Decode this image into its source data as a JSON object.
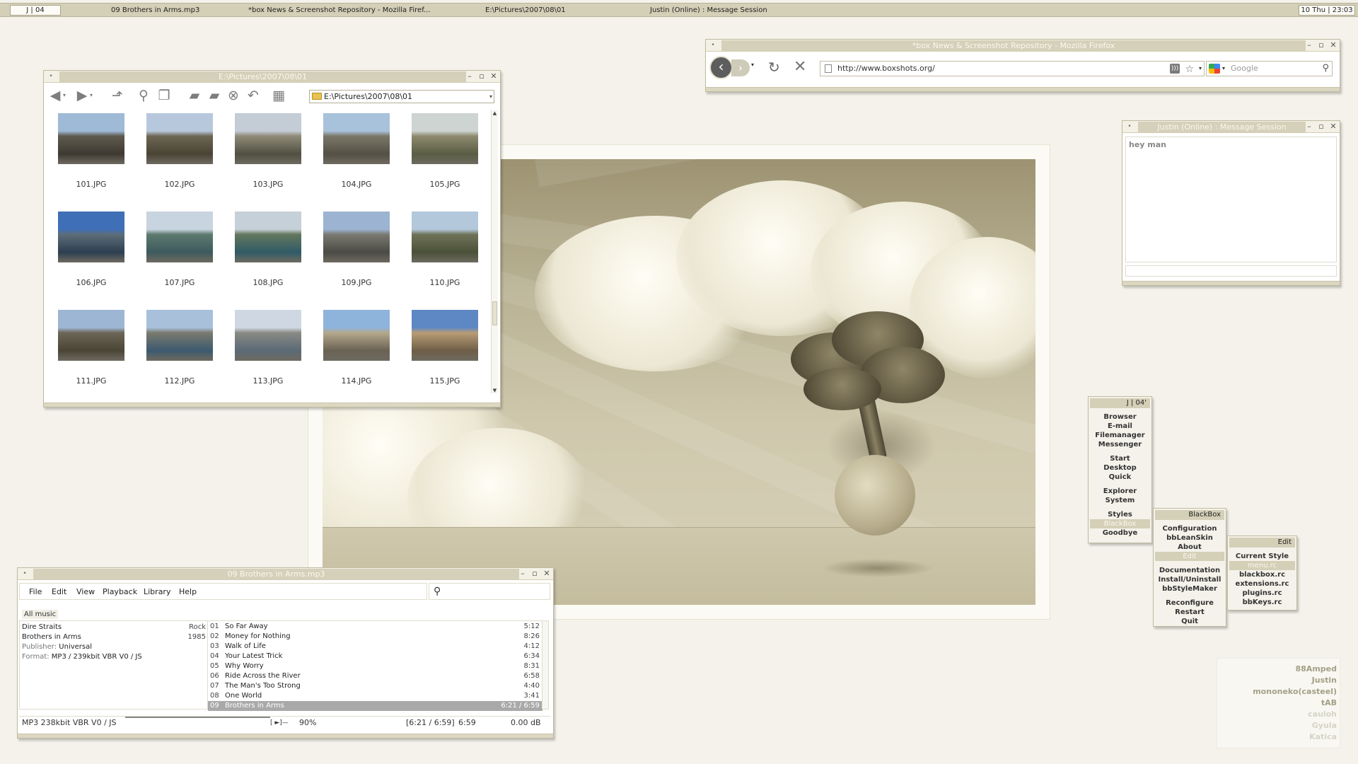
{
  "taskbar": {
    "workspace": "J | 04",
    "tasks": [
      "09 Brothers in Arms.mp3",
      "*box News & Screenshot Repository - Mozilla Firef...",
      "E:\\Pictures\\2007\\08\\01",
      "Justin (Online) : Message Session"
    ],
    "clock": "10 Thu | 23:03"
  },
  "filemanager": {
    "title": "E:\\Pictures\\2007\\08\\01",
    "address": "E:\\Pictures\\2007\\08\\01",
    "thumbnails": [
      "101.JPG",
      "102.JPG",
      "103.JPG",
      "104.JPG",
      "105.JPG",
      "106.JPG",
      "107.JPG",
      "108.JPG",
      "109.JPG",
      "110.JPG",
      "111.JPG",
      "112.JPG",
      "113.JPG",
      "114.JPG",
      "115.JPG"
    ]
  },
  "firefox": {
    "title": "*box News & Screenshot Repository - Mozilla Firefox",
    "url": "http://www.boxshots.org/",
    "search_placeholder": "Google"
  },
  "messenger": {
    "title": "Justin (Online) : Message Session",
    "text": "hey man"
  },
  "player": {
    "title": "09 Brothers in Arms.mp3",
    "menu": [
      "File",
      "Edit",
      "View",
      "Playback",
      "Library",
      "Help"
    ],
    "filter": "All music",
    "info": {
      "artist": "Dire Straits",
      "genre": "Rock",
      "album": "Brothers in Arms",
      "year": "1985",
      "publisher_label": "Publisher:",
      "publisher": "Universal",
      "format_label": "Format:",
      "format": "MP3 / 239kbit VBR V0 / JS"
    },
    "tracks": [
      {
        "no": "01",
        "title": "So Far Away",
        "dur": "5:12"
      },
      {
        "no": "02",
        "title": "Money for Nothing",
        "dur": "8:26"
      },
      {
        "no": "03",
        "title": "Walk of Life",
        "dur": "4:12"
      },
      {
        "no": "04",
        "title": "Your Latest Trick",
        "dur": "6:34"
      },
      {
        "no": "05",
        "title": "Why Worry",
        "dur": "8:31"
      },
      {
        "no": "06",
        "title": "Ride Across the River",
        "dur": "6:58"
      },
      {
        "no": "07",
        "title": "The Man's Too Strong",
        "dur": "4:40"
      },
      {
        "no": "08",
        "title": "One World",
        "dur": "3:41"
      },
      {
        "no": "09",
        "title": "Brothers in Arms",
        "dur": "6:21 / 6:59"
      }
    ],
    "status": {
      "format": "MP3   238kbit VBR V0  /  JS",
      "volume": "90%",
      "position": "[6:21 / 6:59]",
      "length": "6:59",
      "gain": "0.00 dB"
    }
  },
  "bbmenu": {
    "root": {
      "header": "J | 04'",
      "groups": [
        [
          "Browser",
          "E-mail",
          "Filemanager",
          "Messenger"
        ],
        [
          "Start",
          "Desktop",
          "Quick"
        ],
        [
          "Explorer",
          "System"
        ],
        [
          "Styles",
          "BlackBox",
          "Goodbye"
        ]
      ]
    },
    "blackbox": {
      "header": "BlackBox",
      "groups": [
        [
          "Configuration",
          "bbLeanSkin",
          "About",
          "Edit"
        ],
        [
          "Documentation",
          "Install/Uninstall",
          "bbStyleMaker"
        ],
        [
          "Reconfigure",
          "Restart",
          "Quit"
        ]
      ]
    },
    "edit": {
      "header": "Edit",
      "items": [
        "Current Style",
        "menu.rc",
        "blackbox.rc",
        "extensions.rc",
        "plugins.rc",
        "bbKeys.rc"
      ]
    }
  },
  "buddies": {
    "online": [
      "88Amped",
      "Justin",
      "mononeko(casteel)",
      "tAB"
    ],
    "offline": [
      "cauloh",
      "Gyula",
      "Katica"
    ]
  },
  "colors": {
    "accent": "#d4cfb7",
    "desktop": "#f4f2ea",
    "buddy_online": "#a4a086",
    "buddy_offline": "#d6d4c6"
  }
}
